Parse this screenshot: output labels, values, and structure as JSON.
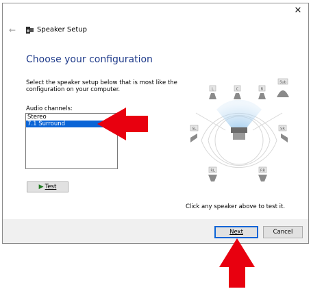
{
  "window": {
    "title": "Speaker Setup",
    "close_glyph": "✕",
    "back_glyph": "←"
  },
  "page": {
    "heading": "Choose your configuration",
    "description": "Select the speaker setup below that is most like the configuration on your computer.",
    "channels_label": "Audio channels:",
    "channels": [
      {
        "label": "Stereo",
        "selected": false
      },
      {
        "label": "7.1 Surround",
        "selected": true
      }
    ],
    "test_button": {
      "icon": "play-icon",
      "label": "Test"
    },
    "hint": "Click any speaker above to test it."
  },
  "speakers": {
    "front_left": "L",
    "center": "C",
    "front_right": "R",
    "subwoofer": "Sub",
    "side_left": "SL",
    "side_right": "SR",
    "rear_left": "RL",
    "rear_right": "RR"
  },
  "footer": {
    "next_label": "Next",
    "cancel_label": "Cancel"
  },
  "colors": {
    "accent": "#0a64d6",
    "heading": "#1e3a8a",
    "annotation_arrow": "#e8000f"
  }
}
